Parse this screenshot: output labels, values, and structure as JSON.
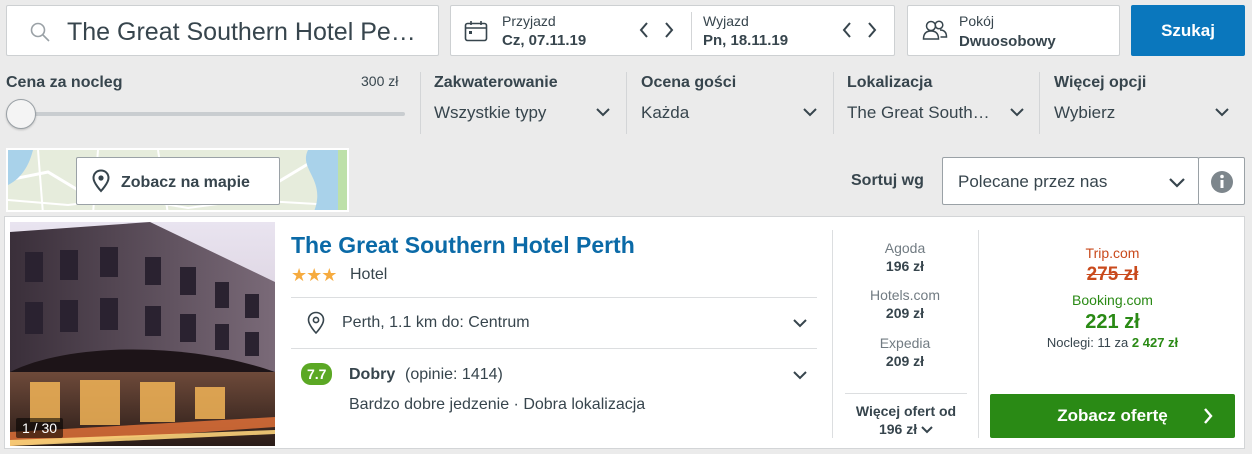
{
  "search": {
    "query": "The Great Southern Hotel Pe…",
    "button": "Szukaj"
  },
  "dates": {
    "checkin_label": "Przyjazd",
    "checkin_value": "Cz, 07.11.19",
    "checkout_label": "Wyjazd",
    "checkout_value": "Pn, 18.11.19"
  },
  "room": {
    "label": "Pokój",
    "value": "Dwuosobowy"
  },
  "filters": {
    "price": {
      "label": "Cena za nocleg",
      "max": "300 zł",
      "slider_fraction": 0.0
    },
    "accommodation": {
      "label": "Zakwaterowanie",
      "value": "Wszystkie typy"
    },
    "rating": {
      "label": "Ocena gości",
      "value": "Każda"
    },
    "location": {
      "label": "Lokalizacja",
      "value": "The Great South…"
    },
    "more": {
      "label": "Więcej opcji",
      "value": "Wybierz"
    }
  },
  "map": {
    "button": "Zobacz na mapie"
  },
  "sort": {
    "label": "Sortuj wg",
    "value": "Polecane przez nas"
  },
  "hotel": {
    "name": "The Great Southern Hotel Perth",
    "stars": 3,
    "type": "Hotel",
    "image_counter": "1 / 30",
    "location": "Perth, 1.1 km do: Centrum",
    "rating_score": "7.7",
    "rating_word": "Dobry",
    "rating_reviews": "(opinie: 1414)",
    "highlights": "Bardzo dobre jedzenie · Dobra lokalizacja",
    "prices": [
      {
        "site": "Agoda",
        "price": "196 zł"
      },
      {
        "site": "Hotels.com",
        "price": "209 zł"
      },
      {
        "site": "Expedia",
        "price": "209 zł"
      }
    ],
    "more_offers_label": "Więcej ofert od",
    "more_offers_price": "196 zł",
    "strike_site": "Trip.com",
    "strike_price": "275 zł",
    "best_site": "Booking.com",
    "best_price": "221 zł",
    "nights_text": "Noclegi: 11 za",
    "nights_total": "2 427 zł",
    "cta": "Zobacz ofertę"
  },
  "colors": {
    "accent": "#0a77bd",
    "deal_green": "#2a8a15",
    "strike_red": "#c94a1c",
    "star": "#f6ab3f",
    "rating_badge": "#5ba824"
  }
}
